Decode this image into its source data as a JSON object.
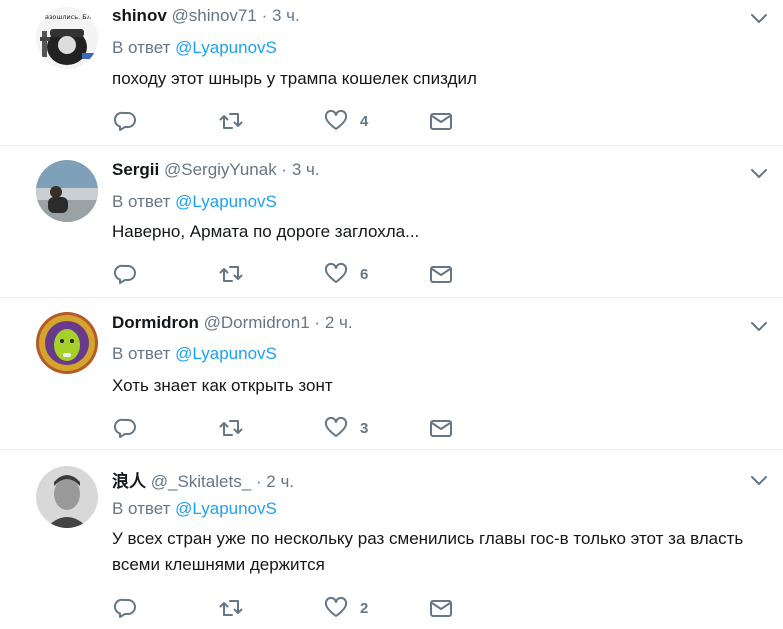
{
  "tweets": [
    {
      "name": "shinov",
      "handle": "@shinov71",
      "dot": " · ",
      "time": "3 ч.",
      "reply_prefix": "В ответ ",
      "reply_to": "@LyapunovS",
      "text": "походу этот шнырь у трампа кошелек спиздил",
      "avatar_text": "Разошлись. Бл.",
      "likes": "4"
    },
    {
      "name": "Sergii",
      "handle": "@SergiyYunak",
      "dot": " · ",
      "time": "3 ч.",
      "reply_prefix": "В ответ ",
      "reply_to": "@LyapunovS",
      "text": "Наверно, Армата по дороге заглохла...",
      "likes": "6"
    },
    {
      "name": "Dormidron",
      "handle": "@Dormidron1",
      "dot": " · ",
      "time": "2 ч.",
      "reply_prefix": "В ответ ",
      "reply_to": "@LyapunovS",
      "text": "Хоть знает как открыть зонт",
      "likes": "3"
    },
    {
      "name": "浪人",
      "handle": "@_Skitalets_",
      "dot": " · ",
      "time": "2 ч.",
      "reply_prefix": "В ответ ",
      "reply_to": "@LyapunovS",
      "text": "У всех стран уже по нескольку раз сменились главы гос-в только этот за власть всеми клешнями держится",
      "likes": "2"
    }
  ],
  "icons": {
    "reply": "reply-icon",
    "retweet": "retweet-icon",
    "like": "heart-icon",
    "dm": "envelope-icon",
    "caret": "chevron-down-icon"
  },
  "colors": {
    "link": "#1da1f2",
    "secondary": "#657786",
    "primary": "#14171a",
    "divider": "#e6ecf0"
  }
}
